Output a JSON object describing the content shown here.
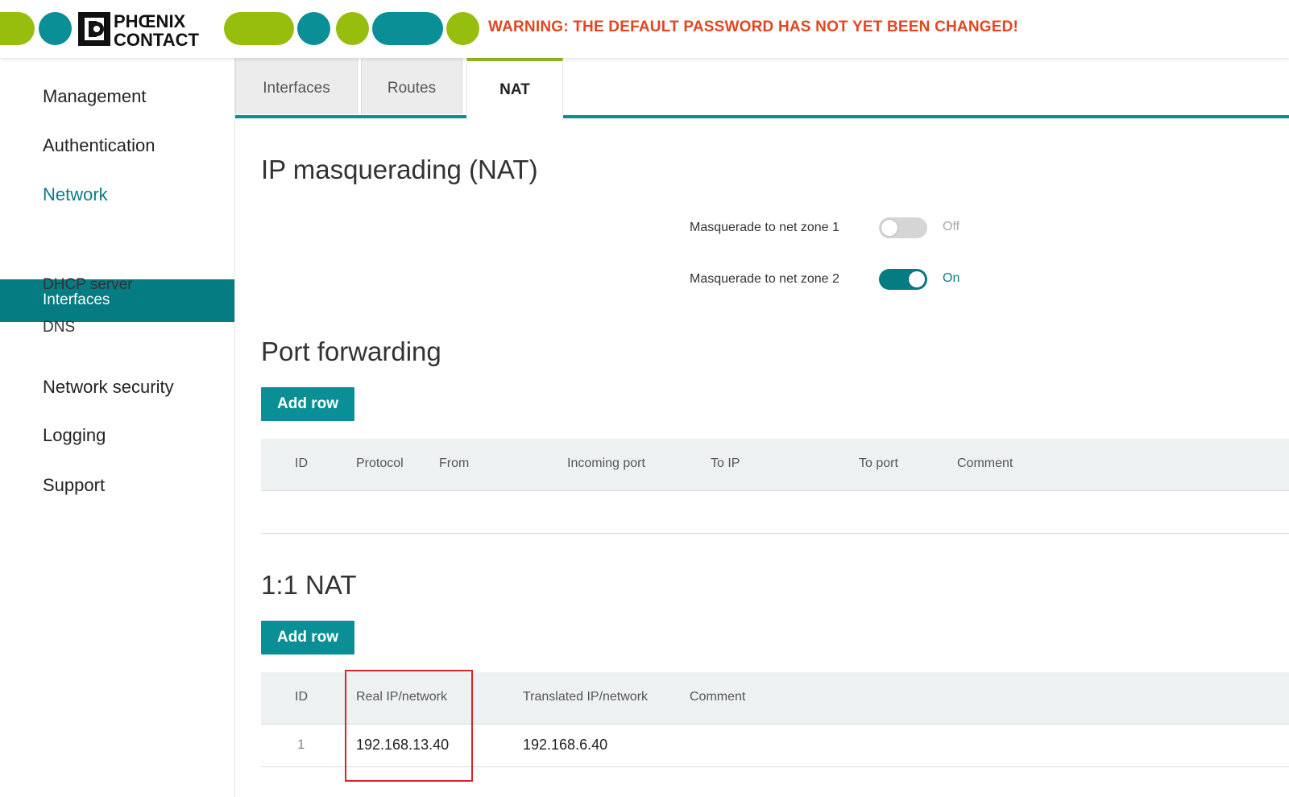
{
  "header": {
    "logo_text_1": "PHŒNIX",
    "logo_text_2": "CONTACT",
    "warning": "WARNING: THE DEFAULT PASSWORD HAS NOT YET BEEN CHANGED!",
    "colors": {
      "green": "#97be0d",
      "teal": "#0a8f96",
      "warning": "#e2461f"
    }
  },
  "sidebar": {
    "items": [
      {
        "label": "Management"
      },
      {
        "label": "Authentication"
      },
      {
        "label": "Network",
        "active": true
      },
      {
        "label": "Network security"
      },
      {
        "label": "Logging"
      },
      {
        "label": "Support"
      }
    ],
    "subitems": [
      {
        "label": "Interfaces",
        "selected": true
      },
      {
        "label": "DHCP server"
      },
      {
        "label": "DNS"
      }
    ]
  },
  "tabs": [
    {
      "label": "Interfaces"
    },
    {
      "label": "Routes"
    },
    {
      "label": "NAT",
      "active": true
    }
  ],
  "masquerading": {
    "title": "IP masquerading (NAT)",
    "zone1": {
      "label": "Masquerade to net zone 1",
      "state": "Off"
    },
    "zone2": {
      "label": "Masquerade to net zone 2",
      "state": "On"
    }
  },
  "port_forwarding": {
    "title": "Port forwarding",
    "add_row": "Add row",
    "columns": [
      "ID",
      "Protocol",
      "From",
      "Incoming port",
      "To IP",
      "To port",
      "Comment"
    ]
  },
  "one_to_one": {
    "title": "1:1 NAT",
    "add_row": "Add row",
    "columns": [
      "ID",
      "Real IP/network",
      "Translated IP/network",
      "Comment"
    ],
    "rows": [
      {
        "id": "1",
        "real": "192.168.13.40",
        "translated": "192.168.6.40",
        "comment": ""
      }
    ]
  }
}
